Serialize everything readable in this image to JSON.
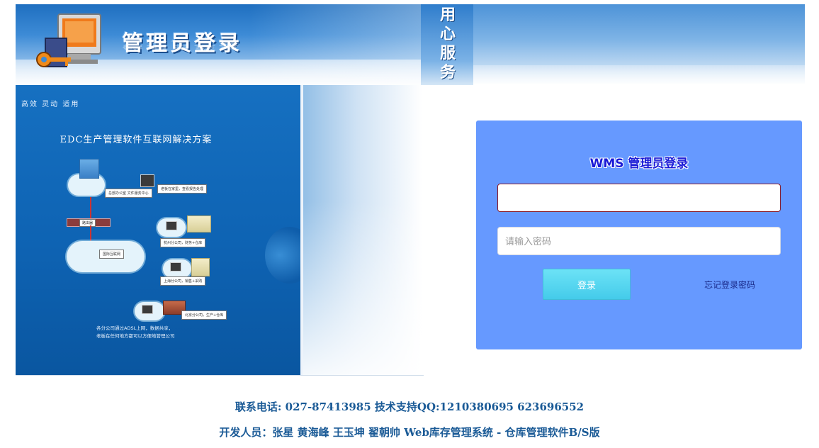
{
  "header": {
    "title": "管理员登录",
    "vertical_slogan": [
      "用",
      "心",
      "服",
      "务"
    ]
  },
  "poster": {
    "tagline": "高效 灵动 适用",
    "title": "EDC生产管理软件互联网解决方案",
    "labels": {
      "center": "总部办公室 文件服务中心",
      "boss": "老板在家里，查看报告处理",
      "router": "路由器",
      "internet": "国际互联网",
      "hangzhou": "杭州分公司，财务+仓库",
      "shanghai": "上海分公司，销售+采购",
      "beijing": "北京分公司，生产+仓库"
    },
    "note_lines": [
      "各分公司通过ADSL上网，数据共享，",
      "老板在任何地方都可以方便地管理公司"
    ]
  },
  "login": {
    "title": "WMS 管理员登录",
    "username_value": "",
    "password_placeholder": "请输入密码",
    "submit_label": "登录",
    "forgot_label": "忘记登录密码"
  },
  "footer": {
    "line1": "联系电话: 027-87413985 技术支持QQ:1210380695 623696552",
    "line2": "开发人员：张星 黄海峰 王玉坤 翟朝帅 Web库存管理系统 - 仓库管理软件B/S版"
  },
  "colors": {
    "login_bg": "#6699ff",
    "login_title": "#1a1ad6",
    "button": "#44cbea",
    "footer_text": "#1a5a96"
  }
}
